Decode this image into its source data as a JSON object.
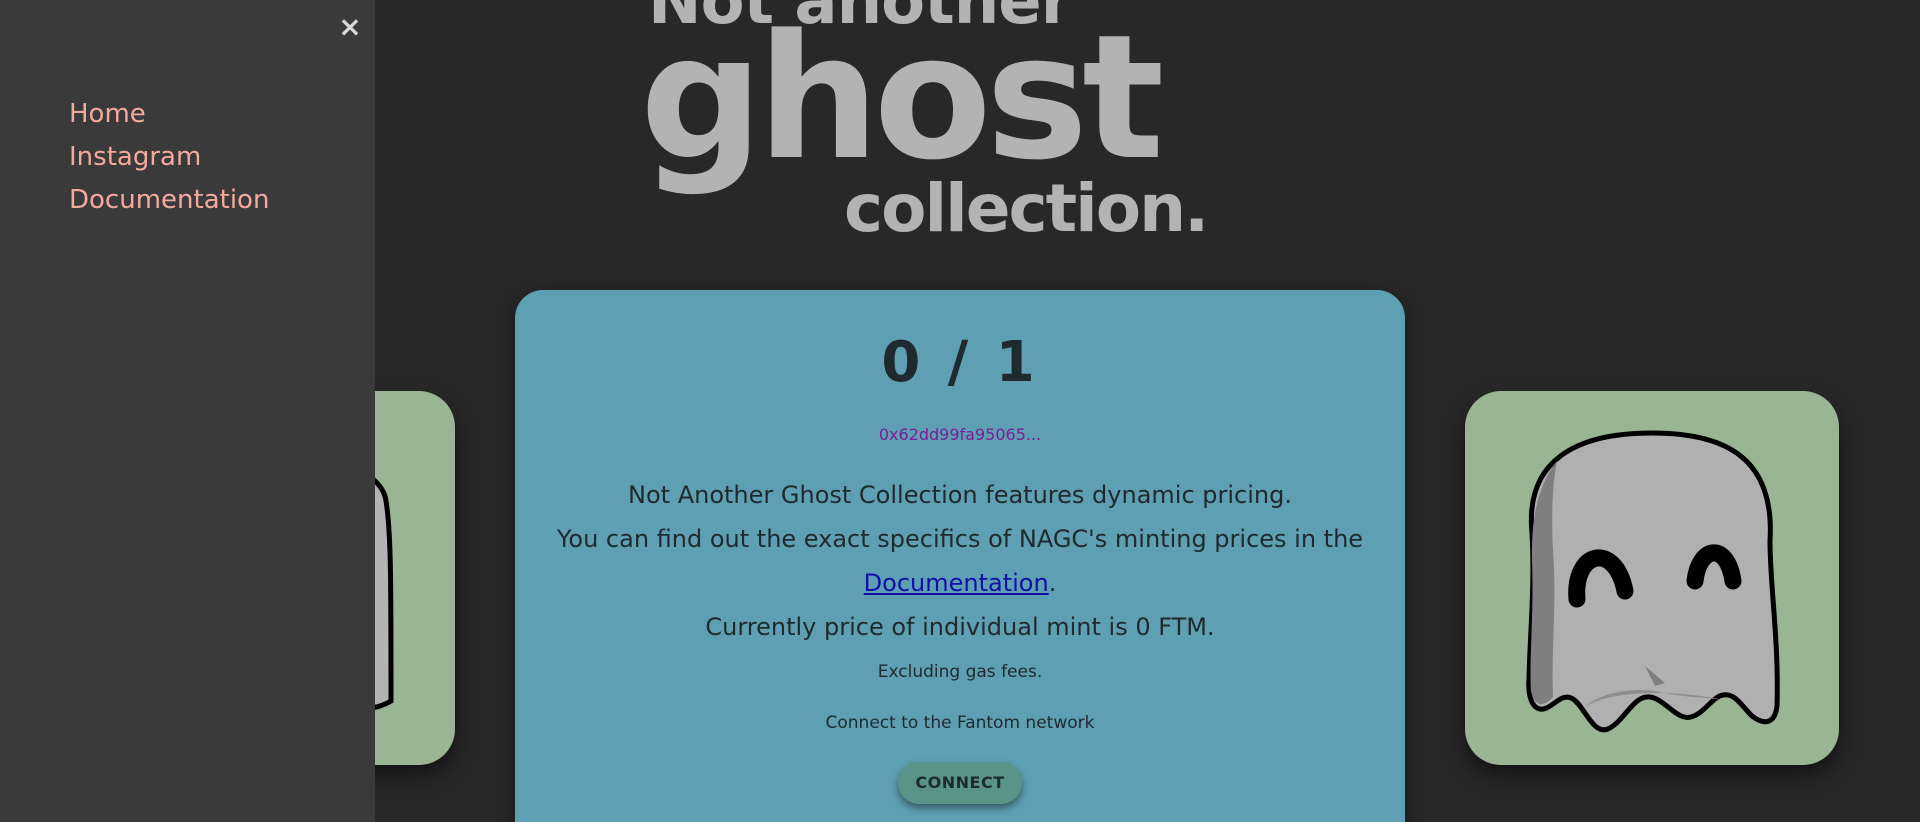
{
  "sidebar": {
    "close_label": "×",
    "items": [
      {
        "label": "Home"
      },
      {
        "label": "Instagram"
      },
      {
        "label": "Documentation"
      }
    ]
  },
  "logo": {
    "line1": "Not another",
    "line2": "ghost",
    "line3": "collection."
  },
  "mint": {
    "counter": "0 / 1",
    "address": "0x62dd99fa95065...",
    "line1": "Not Another Ghost Collection features dynamic pricing.",
    "line2": "You can find out the exact specifics of NAGC's minting prices in the",
    "doc_link": "Documentation",
    "doc_suffix": ".",
    "line3": "Currently price of individual mint is 0 FTM.",
    "gas_note": "Excluding gas fees.",
    "network_note": "Connect to the Fantom network",
    "connect_label": "CONNECT"
  },
  "colors": {
    "background": "#282828",
    "sidebar": "#3a3a3a",
    "nav_link": "#f3aa9c",
    "card": "#5e9fb3",
    "side_card": "#9ab593",
    "address": "#7a1e96",
    "link": "#0f10a8",
    "button": "#5a9387",
    "logo": "#b3b3b3"
  },
  "icons": {
    "close": "close-icon",
    "ghost": "ghost-icon"
  }
}
